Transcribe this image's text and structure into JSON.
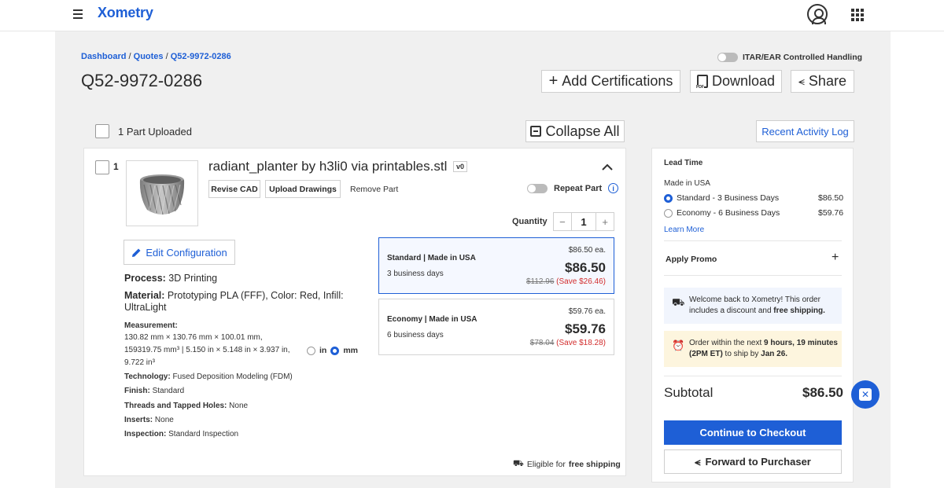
{
  "header": {
    "brand": "Xometry",
    "menu_icon": "hamburger-menu-icon",
    "user_icon": "user-profile-icon",
    "apps_icon": "apps-grid-icon"
  },
  "breadcrumb": {
    "dashboard": "Dashboard",
    "quotes": "Quotes",
    "current": "Q52-9972-0286",
    "sep": " / "
  },
  "quote": {
    "id": "Q52-9972-0286",
    "itar_label": "ITAR/EAR Controlled Handling",
    "add_certifications": "Add Certifications",
    "download": "Download",
    "share": "Share"
  },
  "parts_header": {
    "uploaded": "1 Part Uploaded",
    "collapse_all": "Collapse All",
    "activity_log": "Recent Activity Log"
  },
  "part": {
    "index": "1",
    "name": "radiant_planter by h3li0 via printables.stl",
    "version": "v0",
    "revise_cad": "Revise CAD",
    "upload_drawings": "Upload Drawings",
    "remove_part": "Remove Part",
    "repeat_part": "Repeat Part",
    "quantity_label": "Quantity",
    "quantity": "1",
    "edit_configuration": "Edit Configuration",
    "process_label": "Process:",
    "process": "3D Printing",
    "material_label": "Material:",
    "material": "Prototyping PLA (FFF), Color: Red, Infill: UltraLight",
    "measurement_label": "Measurement:",
    "measurement_line1": "130.82 mm × 130.76 mm × 100.01 mm,",
    "measurement_line2": "159319.75 mm³  |  5.150 in × 5.148 in × 3.937 in,",
    "measurement_line3": "9.722 in³",
    "unit_in": "in",
    "unit_mm": "mm",
    "selected_unit": "mm",
    "technology_label": "Technology:",
    "technology": "Fused Deposition Modeling (FDM)",
    "finish_label": "Finish:",
    "finish": "Standard",
    "threads_label": "Threads and Tapped Holes:",
    "threads": "None",
    "inserts_label": "Inserts:",
    "inserts": "None",
    "inspection_label": "Inspection:",
    "inspection": "Standard Inspection",
    "free_shipping_prefix": "Eligible for ",
    "free_shipping_bold": "free shipping"
  },
  "pricing_options": [
    {
      "title": "Standard | Made in USA",
      "days": "3 business days",
      "each": "$86.50 ea.",
      "price": "$86.50",
      "old": "$112.96",
      "save": "(Save $26.46)",
      "selected": true
    },
    {
      "title": "Economy | Made in USA",
      "days": "6 business days",
      "each": "$59.76 ea.",
      "price": "$59.76",
      "old": "$78.04",
      "save": "(Save $18.28)",
      "selected": false
    }
  ],
  "summary": {
    "lead_time": "Lead Time",
    "made_in": "Made in USA",
    "standard": "Standard - 3 Business Days",
    "standard_price": "$86.50",
    "economy": "Economy - 6 Business Days",
    "economy_price": "$59.76",
    "learn_more": "Learn More",
    "apply_promo": "Apply Promo",
    "welcome_msg": "Welcome back to Xometry! This order includes a discount and ",
    "welcome_bold": "free shipping.",
    "order_prefix": "Order within the next ",
    "order_bold": "9 hours, 19 minutes (2PM ET)",
    "order_mid": " to ship by ",
    "order_date": "Jan 26.",
    "subtotal_label": "Subtotal",
    "subtotal": "$86.50",
    "checkout": "Continue to Checkout",
    "forward": "Forward to Purchaser"
  },
  "colors": {
    "accent": "#1e5fd6",
    "save_red": "#d22c2c",
    "notice_yellow": "#fdf5de",
    "notice_blue": "#f1f5fd"
  }
}
